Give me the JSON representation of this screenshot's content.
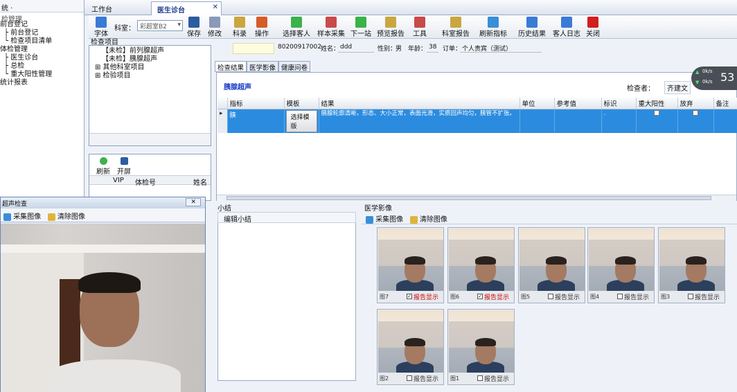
{
  "left_nav": {
    "top_label": "统 ·",
    "section_label": "检管理",
    "items": [
      "前台登记",
      "├ 前台登记",
      "└ 检查项目清单",
      "体检管理",
      "├ 医生诊台",
      "├ 总检",
      "└ 重大阳性管理",
      "统计报表"
    ]
  },
  "tabs": [
    "工作台",
    "医生诊台"
  ],
  "tab_close": "✕",
  "toolbar": {
    "font_label": "字体",
    "dept_label": "科室：",
    "dept_value": "彩超室B2",
    "buttons": [
      "保存",
      "修改",
      "科录",
      "操作",
      "选择客人",
      "样本采集",
      "下一站",
      "预览报告",
      "工具",
      "科室报告",
      "刷新指标",
      "历史结果",
      "客人日志",
      "关闭"
    ]
  },
  "exam_items": {
    "title": "检查项目",
    "items": [
      "【未检】前列腺超声",
      "【未检】胰腺超声",
      "⊞ 其他科室项目",
      "⊞ 检验项目"
    ]
  },
  "queue": {
    "refresh_label": "刷新",
    "open_label": "开屏",
    "columns": [
      "VIP",
      "体检号",
      "姓名"
    ]
  },
  "patient": {
    "id": "80200917002",
    "name_label": "姓名：",
    "name": "ddd",
    "gender_label": "性别：",
    "gender": "男",
    "age_label": "年龄：",
    "age": "38",
    "order_label": "订单：",
    "order": "个人责宾（测试）"
  },
  "result_tabs": [
    "检查结果",
    "医学影像",
    "健康问卷"
  ],
  "result": {
    "section_title": "胰腺超声",
    "examiner_label": "检查者：",
    "examiner": "齐建文",
    "columns": [
      "指标",
      "模板",
      "结果",
      "单位",
      "参考值",
      "标识",
      "重大阳性",
      "放弃",
      "备注"
    ],
    "row": {
      "indicator": "胰",
      "template_button": "选择模版",
      "result_text": "胰腺轮廓清晰，形态、大小正常，表面光滑，实质回声均匀，胰管不扩张。",
      "flag": "."
    }
  },
  "speed_widget": {
    "up": "0k/s",
    "down": "0k/s",
    "percent": "53"
  },
  "summary": {
    "title": "小结",
    "edit_label": "编辑小结"
  },
  "images": {
    "title": "医学影像",
    "capture_label": "采集图像",
    "clear_label": "清除图像",
    "report_label": "报告显示",
    "thumbs": [
      {
        "caption": "图7",
        "checked": true
      },
      {
        "caption": "图6",
        "checked": true
      },
      {
        "caption": "图5",
        "checked": false
      },
      {
        "caption": "图4",
        "checked": false
      },
      {
        "caption": "图3",
        "checked": false
      },
      {
        "caption": "图2",
        "checked": false
      },
      {
        "caption": "图1",
        "checked": false
      }
    ]
  },
  "camera": {
    "title": "超声检查",
    "close": "✕",
    "capture_label": "采集图像",
    "clear_label": "清除图像"
  }
}
